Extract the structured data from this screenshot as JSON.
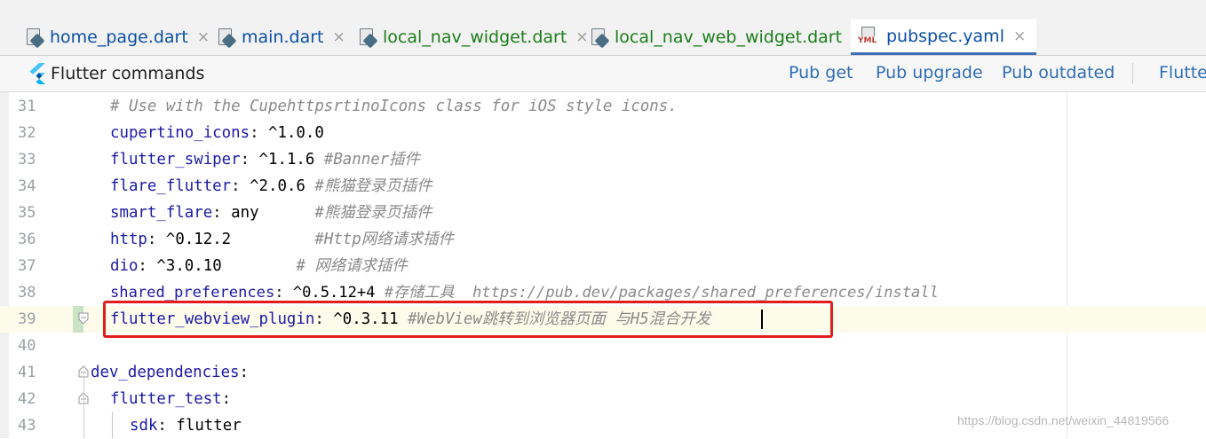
{
  "tabs": [
    {
      "label": "home_page.dart",
      "close": "×"
    },
    {
      "label": "main.dart",
      "close": "×"
    },
    {
      "label": "local_nav_widget.dart",
      "close": "×"
    },
    {
      "label": "local_nav_web_widget.dart",
      "close": "×"
    },
    {
      "label": "pubspec.yaml",
      "close": "×",
      "icon_text": "YML"
    }
  ],
  "commands": {
    "title": "Flutter commands",
    "pub_get": "Pub get",
    "pub_upgrade": "Pub upgrade",
    "pub_outdated": "Pub outdated",
    "flutter": "Flutter"
  },
  "lines": [
    {
      "num": "31",
      "comment": "# Use with the CupehttpsrtinoIcons class for iOS style icons."
    },
    {
      "num": "32",
      "key": "cupertino_icons",
      "colon": ": ",
      "value": "^1.0.0"
    },
    {
      "num": "33",
      "key": "flutter_swiper",
      "colon": ": ",
      "value": "^1.1.6 ",
      "comment": "#Banner插件"
    },
    {
      "num": "34",
      "key": "flare_flutter",
      "colon": ": ",
      "value": "^2.0.6 ",
      "comment": "#熊猫登录页插件"
    },
    {
      "num": "35",
      "key": "smart_flare",
      "colon": ": ",
      "value": "any      ",
      "comment": "#熊猫登录页插件"
    },
    {
      "num": "36",
      "key": "http",
      "colon": ": ",
      "value": "^0.12.2         ",
      "comment": "#Http网络请求插件"
    },
    {
      "num": "37",
      "key": "dio",
      "colon": ": ",
      "value": "^3.0.10        ",
      "comment": "# 网络请求插件"
    },
    {
      "num": "38",
      "key": "shared_preferences",
      "colon": ": ",
      "value": "^0.5.12+4 ",
      "comment": "#存储工具  https://pub.dev/packages/shared_preferences/install"
    },
    {
      "num": "39",
      "key": "flutter_webview_plugin",
      "colon": ": ",
      "value": "^0.3.11 ",
      "comment": "#WebView跳转到浏览器页面 与H5混合开发"
    },
    {
      "num": "40"
    },
    {
      "num": "41",
      "key": "dev_dependencies",
      "colon": ":"
    },
    {
      "num": "42",
      "key": "flutter_test",
      "colon": ":"
    },
    {
      "num": "43",
      "key": "sdk",
      "colon": ": ",
      "value": "flutter"
    }
  ],
  "watermark": "https://blog.csdn.net/weixin_44819566"
}
